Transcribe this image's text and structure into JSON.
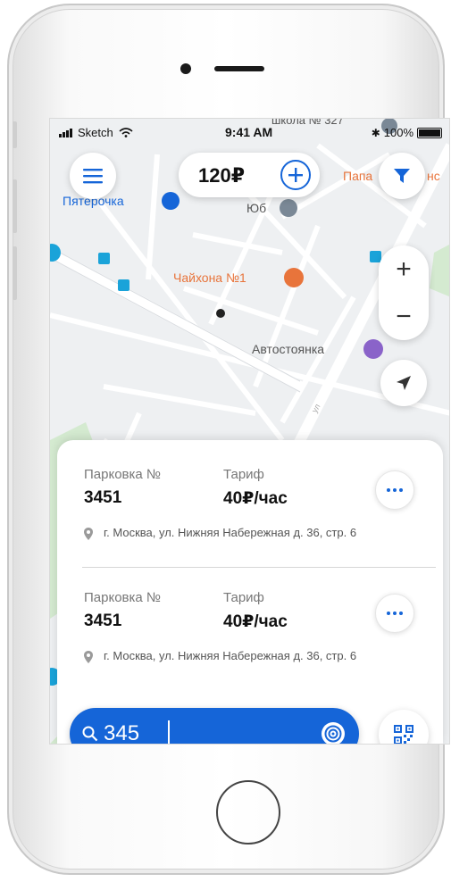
{
  "status_bar": {
    "carrier": "Sketch",
    "time": "9:41 AM",
    "battery": "100%"
  },
  "map": {
    "pois": [
      {
        "name": "Пятёрочка",
        "color": "#1565d8"
      },
      {
        "name": "Юб",
        "color": "#555555"
      },
      {
        "name": "Чайхона №1",
        "color": "#e8743b"
      },
      {
        "name": "Автостоянка",
        "color": "#555555"
      },
      {
        "name": "Папа",
        "color": "#e8743b"
      },
      {
        "name": "нс",
        "color": "#e8743b"
      },
      {
        "name": "школа № 327",
        "color": "#555555"
      }
    ]
  },
  "balance": {
    "amount": "120₽"
  },
  "zoom": {
    "in": "+",
    "out": "−"
  },
  "parking_list": [
    {
      "parking_label": "Парковка №",
      "parking_number": "3451",
      "tariff_label": "Тариф",
      "tariff_value": "40₽/час",
      "address": "г. Москва, ул. Нижняя Набережная д. 36, стр. 6"
    },
    {
      "parking_label": "Парковка №",
      "parking_number": "3451",
      "tariff_label": "Тариф",
      "tariff_value": "40₽/час",
      "address": "г. Москва, ул. Нижняя Набережная д. 36, стр. 6"
    }
  ],
  "search": {
    "value": "345"
  },
  "colors": {
    "accent": "#1565d8",
    "poi_orange": "#e8743b",
    "map_bg": "#eef0f2",
    "park_green": "#d4ead0"
  },
  "icons": [
    "menu-icon",
    "plus-icon",
    "filter-icon",
    "locate-icon",
    "more-icon",
    "pin-icon",
    "search-icon",
    "target-icon",
    "qr-code-icon"
  ]
}
